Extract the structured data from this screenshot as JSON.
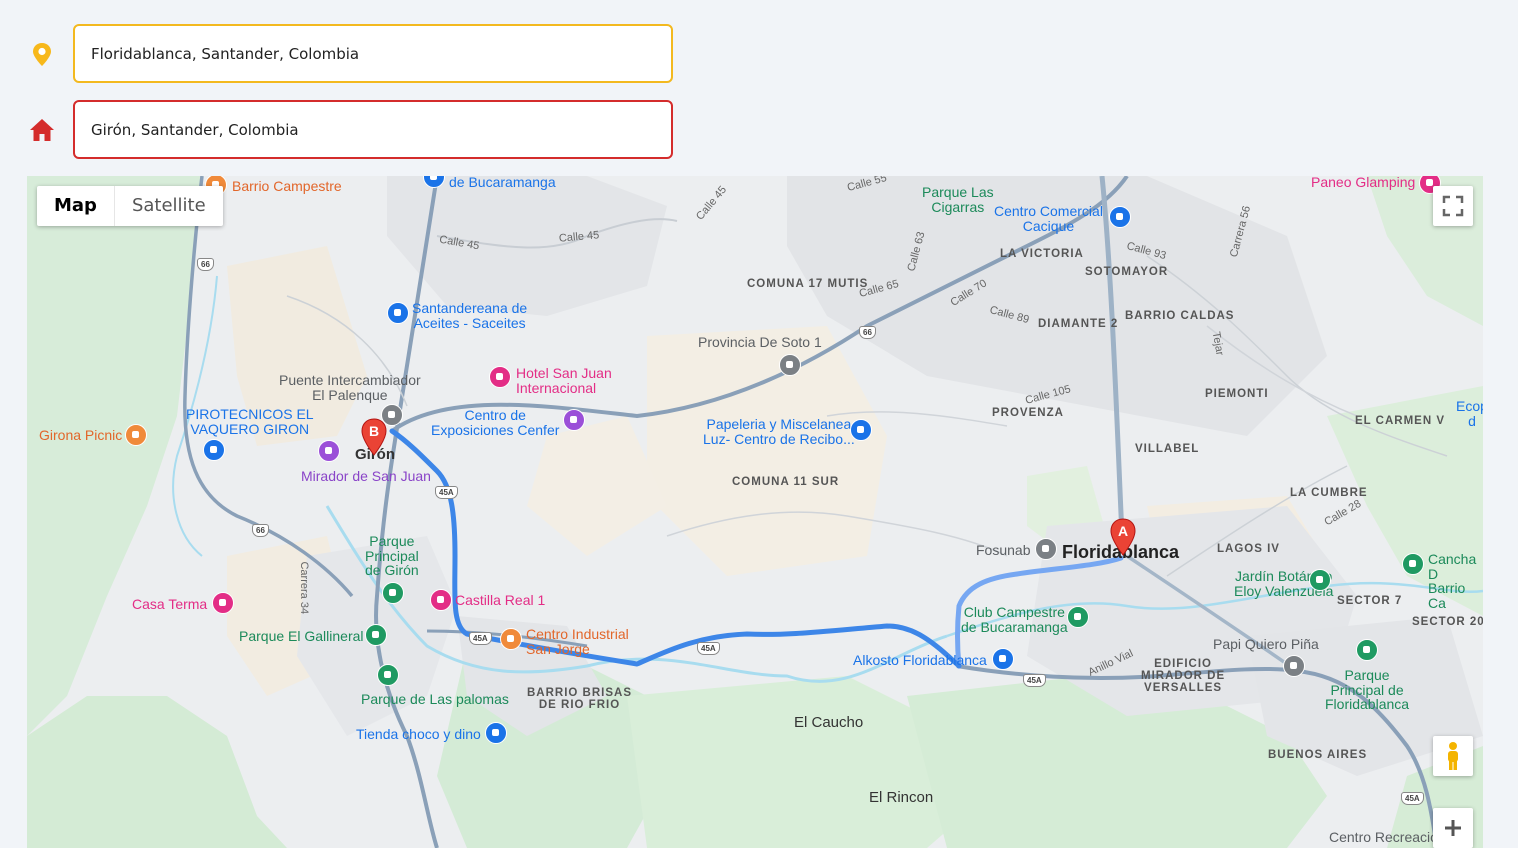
{
  "origin": {
    "value": "Floridablanca, Santander, Colombia",
    "color": "#f3b91f",
    "icon": "location-pin-icon"
  },
  "destination": {
    "value": "Girón, Santander, Colombia",
    "color": "#d42c2c",
    "icon": "home-icon"
  },
  "map": {
    "type_control": {
      "map_label": "Map",
      "satellite_label": "Satellite",
      "selected": "Map"
    },
    "route_color": "#4285f4",
    "markers": {
      "a": "A",
      "b": "B"
    },
    "places": {
      "giron": "Girón",
      "floridablanca": "Floridablanca",
      "el_caucho": "El Caucho",
      "el_rincon": "El Rincon"
    },
    "areas": {
      "comuna_17": "COMUNA\n17 MUTIS",
      "comuna_11": "COMUNA\n11 SUR",
      "la_victoria": "LA VICTORIA",
      "sotomayor": "SOTOMAYOR",
      "diamante_2": "DIAMANTE 2",
      "barrio_caldas": "BARRIO CALDAS",
      "piemonti": "PIEMONTI",
      "provenza": "PROVENZA",
      "el_carmen": "EL CARMEN V",
      "villabel": "VILLABEL",
      "la_cumbre": "LA CUMBRE",
      "lagos_iv": "LAGOS IV",
      "sector_7": "SECTOR 7",
      "sector_20": "SECTOR 20",
      "edificio_mirador": "EDIFICIO\nMIRADOR DE\nVERSALLES",
      "buenos_aires": "BUENOS AIRES",
      "barrio_brisas": "BARRIO BRISAS\nDE RIO FRIO"
    },
    "pois": {
      "restaurante": "Restaurante\nBarrio Campestre",
      "de_bucaramanga": "de Bucaramanga",
      "parque_cigarras": "Parque Las\nCigarras",
      "cc_cacique": "Centro Comercial\nCacique",
      "paneo_glamping": "Paneo Glamping",
      "santandereana": "Santandereana de\nAceites - Saceites",
      "provincia_soto": "Provincia De Soto 1",
      "hotel_san_juan": "Hotel San Juan\nInternacional",
      "puente_intercambiador": "Puente Intercambiador\nEl Palenque",
      "pirotecnicos": "PIROTECNICOS EL\nVAQUERO GIRON",
      "girona_picnic": "Girona Picnic",
      "centro_exposiciones": "Centro de\nExposiciones Cenfer",
      "papeleria": "Papeleria y Miscelanea\nLuz- Centro de Recibo...",
      "mirador_san_juan": "Mirador de San Juan",
      "parque_principal_giron": "Parque\nPrincipal\nde Girón",
      "casa_terma": "Casa Terma",
      "castilla_real": "Castilla Real 1",
      "parque_gallineral": "Parque El Gallineral",
      "centro_industrial": "Centro Industrial\nSan Jorge",
      "parque_palomas": "Parque de Las palomas",
      "tienda_choco": "Tienda choco y dino",
      "fosunab": "Fosunab",
      "club_campestre": "Club Campestre\nde Bucaramanga",
      "alkosto": "Alkosto Floridablanca",
      "jardin_botanico": "Jardín Botánico\nEloy Valenzuela",
      "cancha": "Cancha D\nBarrio Ca",
      "papi_quiero": "Papi Quiero Piña",
      "parque_principal_flor": "Parque\nPrincipal de\nFloridablanca",
      "centro_recreacion": "Centro Recreacio",
      "ecop": "Ecop\nd"
    },
    "streets": {
      "calle45a": "Calle 45",
      "calle45b": "Calle 45",
      "calle45c": "Calle 45",
      "calle55": "Calle 55",
      "calle63": "Calle 63",
      "calle65": "Calle 65",
      "calle70": "Calle 70",
      "calle89": "Calle 89",
      "calle93": "Calle 93",
      "calle105": "Calle 105",
      "carrera56": "Carrera 56",
      "carrera34": "Carrera 34",
      "calle28": "Calle 28",
      "tejar": "Tejar",
      "anillo_vial": "Anillo Vial"
    },
    "highways": {
      "h66a": "66",
      "h66b": "66",
      "h66c": "66",
      "h45a1": "45A",
      "h45a2": "45A",
      "h45a3": "45A",
      "h45a4": "45A",
      "h45a5": "45A"
    }
  }
}
